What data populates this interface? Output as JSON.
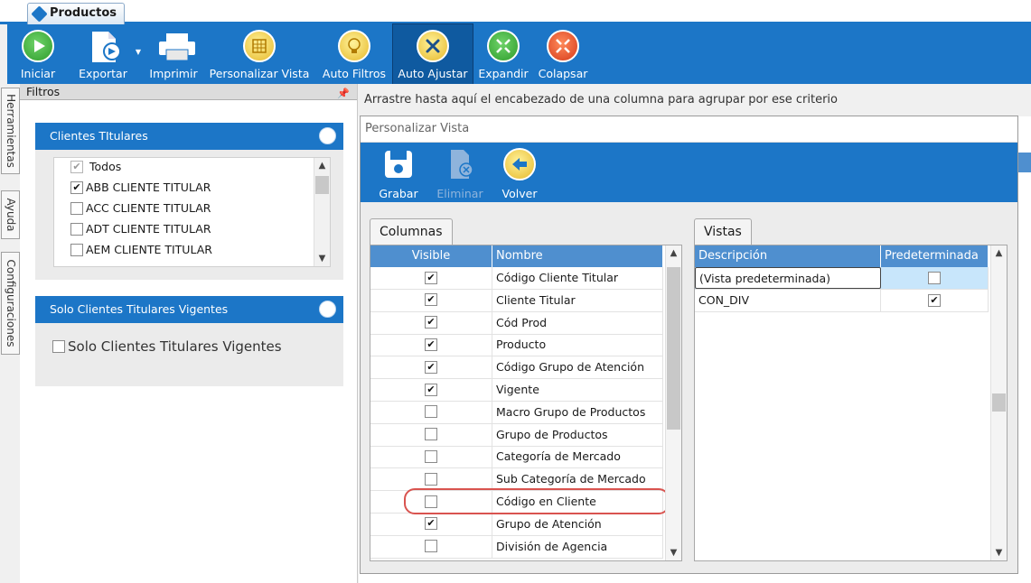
{
  "window": {
    "tab_title": "Productos"
  },
  "toolbar": {
    "buttons": [
      {
        "label": "Iniciar",
        "icon": "play-icon",
        "color": "#4caf50"
      },
      {
        "label": "Exportar",
        "icon": "export-document-icon"
      },
      {
        "label": "Imprimir",
        "icon": "printer-icon"
      },
      {
        "label": "Personalizar Vista",
        "icon": "customize-grid-icon",
        "color": "#f2d04a"
      },
      {
        "label": "Auto Filtros",
        "icon": "filter-lamp-icon",
        "color": "#f2d04a"
      },
      {
        "label": "Auto Ajustar",
        "icon": "tools-icon",
        "color": "#f2d04a",
        "active": true
      },
      {
        "label": "Expandir",
        "icon": "expand-arrows-icon",
        "color": "#4caf50"
      },
      {
        "label": "Colapsar",
        "icon": "collapse-arrows-icon",
        "color": "#e53935"
      }
    ]
  },
  "side_tabs": [
    "Herramientas",
    "Ayuda",
    "Configuraciones"
  ],
  "filters": {
    "title": "Filtros",
    "clientes": {
      "title": "Clientes TItulares",
      "items": [
        {
          "label": "Todos",
          "checked": true,
          "gray": true
        },
        {
          "label": "ABB CLIENTE TITULAR",
          "checked": true
        },
        {
          "label": "ACC CLIENTE TITULAR",
          "checked": false
        },
        {
          "label": "ADT CLIENTE TITULAR",
          "checked": false
        },
        {
          "label": "AEM CLIENTE TITULAR",
          "checked": false
        }
      ]
    },
    "vigentes": {
      "title": "Solo Clientes Titulares Vigentes",
      "checkbox_label": "Solo Clientes Titulares Vigentes",
      "checked": false
    }
  },
  "main": {
    "group_hint": "Arrastre hasta aquí el encabezado de una columna para agrupar por ese criterio"
  },
  "personalizar": {
    "title": "Personalizar Vista",
    "buttons": [
      {
        "label": "Grabar",
        "icon": "save-icon"
      },
      {
        "label": "Eliminar",
        "icon": "delete-document-icon",
        "disabled": true
      },
      {
        "label": "Volver",
        "icon": "back-arrow-icon"
      }
    ],
    "columnas": {
      "tab": "Columnas",
      "headers": [
        "Visible",
        "Nombre"
      ],
      "rows": [
        {
          "visible": true,
          "name": "Código Cliente Titular"
        },
        {
          "visible": true,
          "name": "Cliente Titular"
        },
        {
          "visible": true,
          "name": "Cód Prod"
        },
        {
          "visible": true,
          "name": "Producto"
        },
        {
          "visible": true,
          "name": "Código Grupo de Atención"
        },
        {
          "visible": true,
          "name": "Vigente"
        },
        {
          "visible": false,
          "name": "Macro Grupo de Productos"
        },
        {
          "visible": false,
          "name": "Grupo de Productos"
        },
        {
          "visible": false,
          "name": "Categoría de Mercado"
        },
        {
          "visible": false,
          "name": "Sub Categoría de Mercado"
        },
        {
          "visible": false,
          "name": "Código en Cliente"
        },
        {
          "visible": true,
          "name": "Grupo de Atención",
          "highlighted": true
        },
        {
          "visible": false,
          "name": "División de Agencia"
        }
      ]
    },
    "vistas": {
      "tab": "Vistas",
      "headers": [
        "Descripción",
        "Predeterminada"
      ],
      "rows": [
        {
          "descripcion": "(Vista predeterminada)",
          "predeterminada": false,
          "selected": true
        },
        {
          "descripcion": "CON_DIV",
          "predeterminada": true
        }
      ]
    }
  },
  "colors": {
    "accent": "#1c76c7",
    "grid_header": "#4f8fcf",
    "highlight": "#d9534f"
  }
}
